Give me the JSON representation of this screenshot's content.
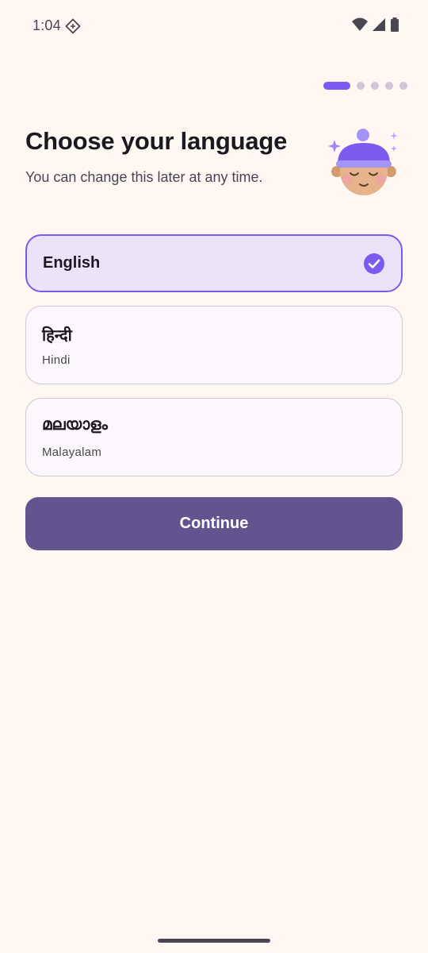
{
  "status_bar": {
    "time": "1:04",
    "icons": [
      "link-badge-icon",
      "wifi-icon",
      "signal-icon",
      "battery-icon"
    ]
  },
  "onboarding": {
    "step": 1,
    "total_steps": 5
  },
  "header": {
    "title": "Choose your language",
    "subtitle": "You can change this later at any time."
  },
  "languages": [
    {
      "name": "English",
      "subtitle": "",
      "selected": true
    },
    {
      "name": "हिन्दी",
      "subtitle": "Hindi",
      "selected": false
    },
    {
      "name": "മലയാളം",
      "subtitle": "Malayalam",
      "selected": false
    }
  ],
  "actions": {
    "continue_label": "Continue"
  },
  "colors": {
    "background": "#FFF7F2",
    "accent": "#7A5AF0",
    "button": "#62558F",
    "selected_fill": "#EBE3FA",
    "card_border": "#CFC7D6"
  }
}
